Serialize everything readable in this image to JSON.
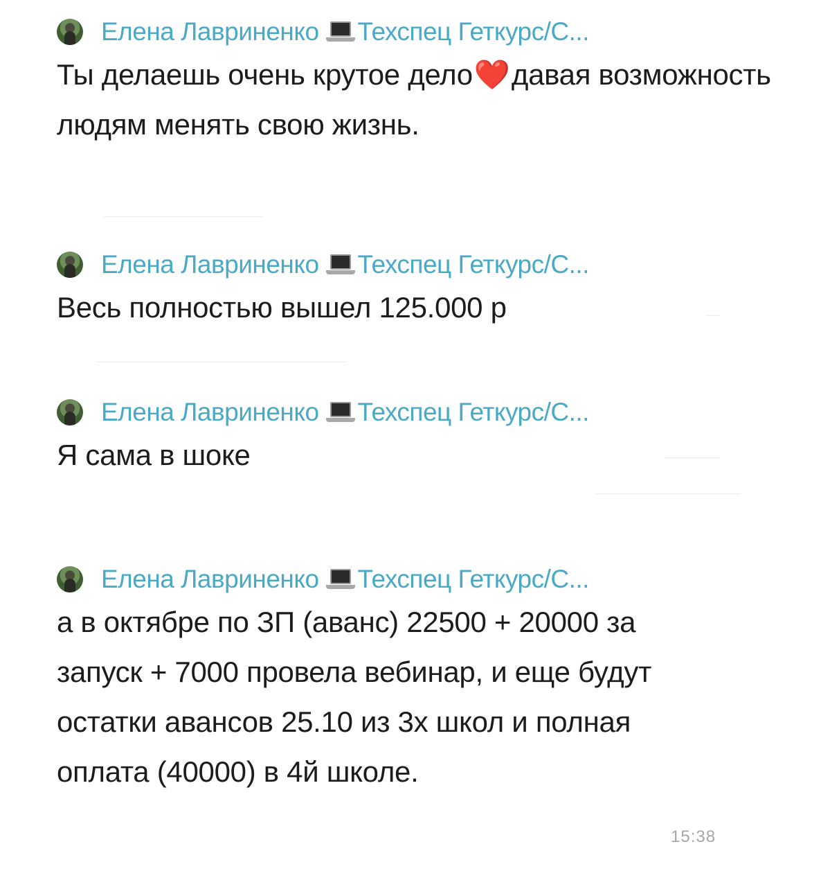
{
  "messages": [
    {
      "sender": "Елена Лавриненко",
      "group": "Техспец Геткурс/С...",
      "text_before_heart": "Ты делаешь очень крутое дело",
      "heart": "❤️",
      "text_after_heart": "давая возможность людям менять свою жизнь."
    },
    {
      "sender": "Елена Лавриненко",
      "group": "Техспец Геткурс/С...",
      "text": "Весь полностью вышел 125.000 р"
    },
    {
      "sender": "Елена Лавриненко",
      "group": "Техспец Геткурс/С...",
      "text": "Я сама в шоке"
    },
    {
      "sender": "Елена Лавриненко",
      "group": "Техспец Геткурс/С...",
      "text": "а  в октябре по ЗП (аванс) 22500 + 20000 за запуск + 7000 провела вебинар, и еще будут остатки авансов 25.10 из 3х школ и полная оплата (40000) в 4й школе.",
      "time": "15:38"
    }
  ],
  "colors": {
    "sender": "#4aa9c4",
    "text": "#1c1c1c",
    "time": "#a7a7a7",
    "heart": "#e2263b"
  },
  "icons": {
    "avatar": "avatar",
    "laptop": "laptop-icon"
  }
}
